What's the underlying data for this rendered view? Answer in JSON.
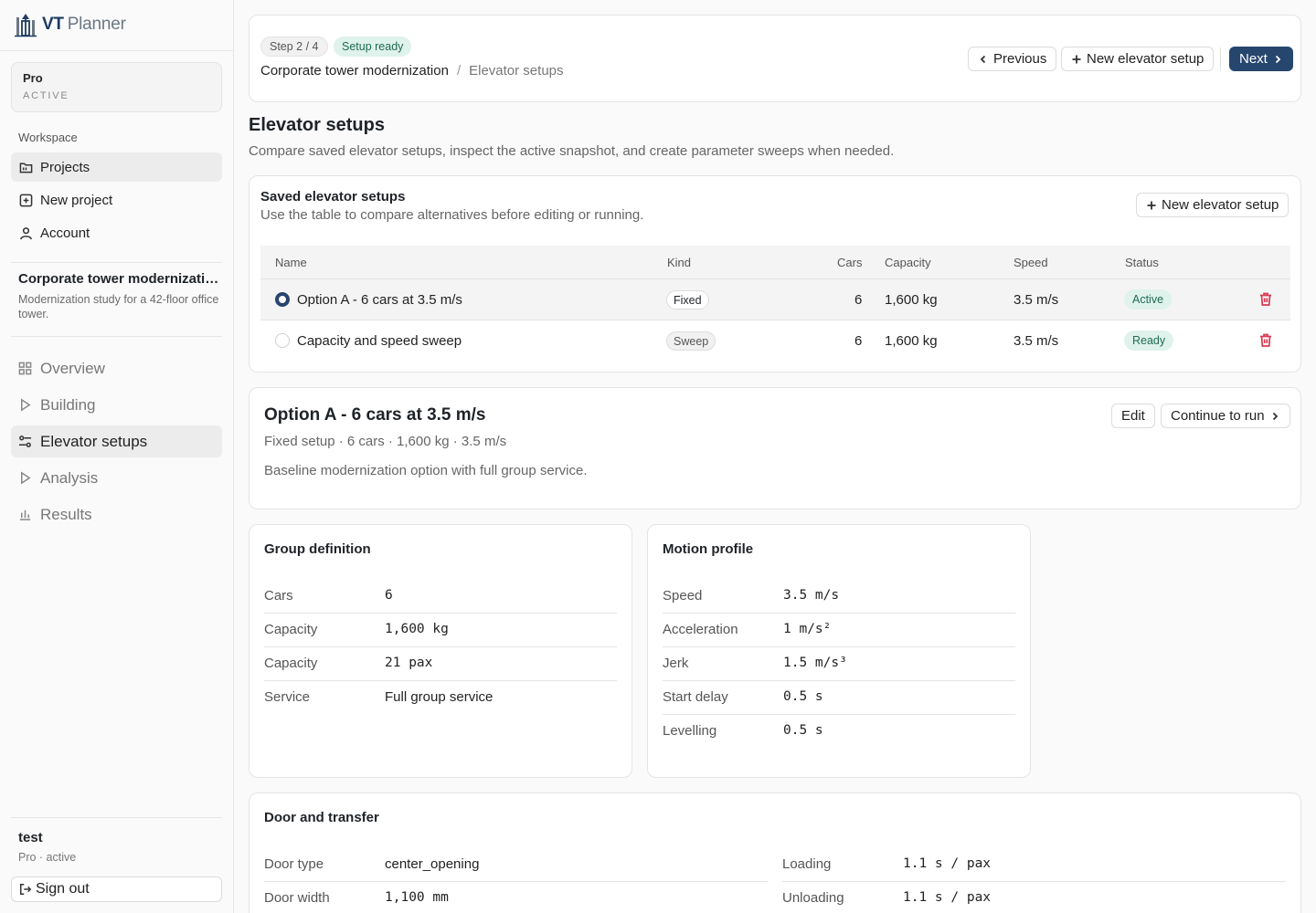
{
  "brand": {
    "vt": "VT",
    "planner": "Planner"
  },
  "plan": {
    "name": "Pro",
    "status": "ACTIVE"
  },
  "sidebar": {
    "section": "Workspace",
    "items": [
      {
        "label": "Projects"
      },
      {
        "label": "New project"
      },
      {
        "label": "Account"
      }
    ],
    "project": {
      "name": "Corporate tower modernization",
      "description": "Modernization study for a 42-floor office tower."
    },
    "steps": [
      {
        "label": "Overview"
      },
      {
        "label": "Building"
      },
      {
        "label": "Elevator setups"
      },
      {
        "label": "Analysis"
      },
      {
        "label": "Results"
      }
    ],
    "user": {
      "name": "test",
      "plan": "Pro · active",
      "signout": "Sign out"
    }
  },
  "header": {
    "step": "Step 2 / 4",
    "status": "Setup ready",
    "breadcrumb": {
      "project": "Corporate tower modernization",
      "sep": "/",
      "current": "Elevator setups"
    },
    "previous": "Previous",
    "new_setup": "New elevator setup",
    "next": "Next"
  },
  "page": {
    "title": "Elevator setups",
    "subtitle": "Compare saved elevator setups, inspect the active snapshot, and create parameter sweeps when needed."
  },
  "saved": {
    "title": "Saved elevator setups",
    "subtitle": "Use the table to compare alternatives before editing or running.",
    "new_button": "New elevator setup",
    "columns": {
      "name": "Name",
      "kind": "Kind",
      "cars": "Cars",
      "capacity": "Capacity",
      "speed": "Speed",
      "status": "Status"
    },
    "rows": [
      {
        "name": "Option A - 6 cars at 3.5 m/s",
        "kind": "Fixed",
        "cars": "6",
        "capacity": "1,600 kg",
        "speed": "3.5 m/s",
        "status": "Active",
        "selected": true
      },
      {
        "name": "Capacity and speed sweep",
        "kind": "Sweep",
        "cars": "6",
        "capacity": "1,600 kg",
        "speed": "3.5 m/s",
        "status": "Ready",
        "selected": false
      }
    ]
  },
  "detail": {
    "title": "Option A - 6 cars at 3.5 m/s",
    "meta": "Fixed setup · 6 cars · 1,600 kg · 3.5 m/s",
    "description": "Baseline modernization option with full group service.",
    "edit": "Edit",
    "continue": "Continue to run"
  },
  "group": {
    "title": "Group definition",
    "rows": [
      {
        "k": "Cars",
        "v": "6"
      },
      {
        "k": "Capacity",
        "v": "1,600 kg"
      },
      {
        "k": "Capacity",
        "v": "21 pax"
      },
      {
        "k": "Service",
        "v": "Full group service"
      }
    ]
  },
  "motion": {
    "title": "Motion profile",
    "rows": [
      {
        "k": "Speed",
        "v": "3.5 m/s"
      },
      {
        "k": "Acceleration",
        "v": "1 m/s²"
      },
      {
        "k": "Jerk",
        "v": "1.5 m/s³"
      },
      {
        "k": "Start delay",
        "v": "0.5 s"
      },
      {
        "k": "Levelling",
        "v": "0.5 s"
      }
    ]
  },
  "door": {
    "title": "Door and transfer",
    "left": [
      {
        "k": "Door type",
        "v": "center_opening"
      },
      {
        "k": "Door width",
        "v": "1,100 mm"
      }
    ],
    "right": [
      {
        "k": "Loading",
        "v": "1.1 s / pax"
      },
      {
        "k": "Unloading",
        "v": "1.1 s / pax"
      }
    ]
  },
  "colors": {
    "primary": "#27466e",
    "success_bg": "#dff2ec",
    "success_text": "#1f6b53",
    "danger": "#d83a52"
  }
}
